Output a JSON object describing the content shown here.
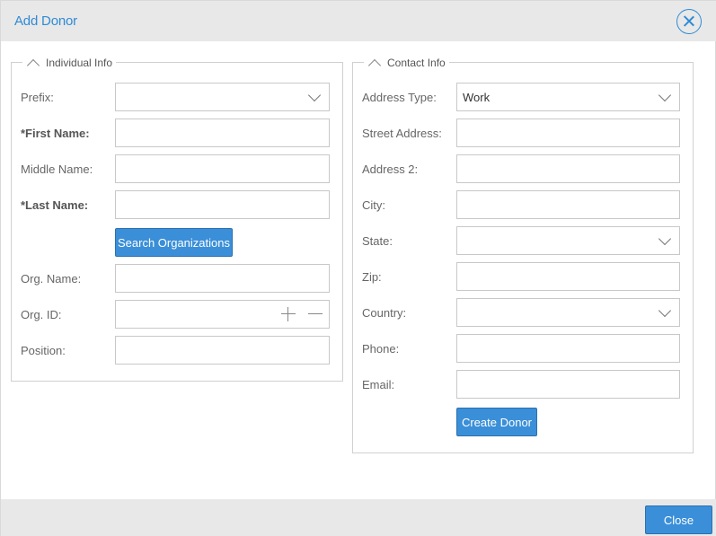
{
  "dialog": {
    "title": "Add Donor",
    "close_label": "Close"
  },
  "individual": {
    "legend": "Individual Info",
    "prefix_label": "Prefix:",
    "prefix_value": "",
    "first_name_label": "*First Name:",
    "first_name_value": "",
    "middle_name_label": "Middle Name:",
    "middle_name_value": "",
    "last_name_label": "*Last Name:",
    "last_name_value": "",
    "search_orgs_label": "Search Organizations",
    "org_name_label": "Org. Name:",
    "org_name_value": "",
    "org_id_label": "Org. ID:",
    "org_id_value": "",
    "position_label": "Position:",
    "position_value": ""
  },
  "contact": {
    "legend": "Contact Info",
    "address_type_label": "Address Type:",
    "address_type_value": "Work",
    "street_label": "Street Address:",
    "street_value": "",
    "address2_label": "Address 2:",
    "address2_value": "",
    "city_label": "City:",
    "city_value": "",
    "state_label": "State:",
    "state_value": "",
    "zip_label": "Zip:",
    "zip_value": "",
    "country_label": "Country:",
    "country_value": "",
    "phone_label": "Phone:",
    "phone_value": "",
    "email_label": "Email:",
    "email_value": "",
    "create_label": "Create Donor"
  },
  "icons": {
    "close": "close-circle-icon",
    "collapse": "chevron-up-icon",
    "dropdown": "chevron-down-icon",
    "increment": "plus-icon",
    "decrement": "minus-icon"
  },
  "colors": {
    "accent": "#3a8fd8",
    "title": "#2e8bd6",
    "header_bg": "#e8e8e8"
  }
}
